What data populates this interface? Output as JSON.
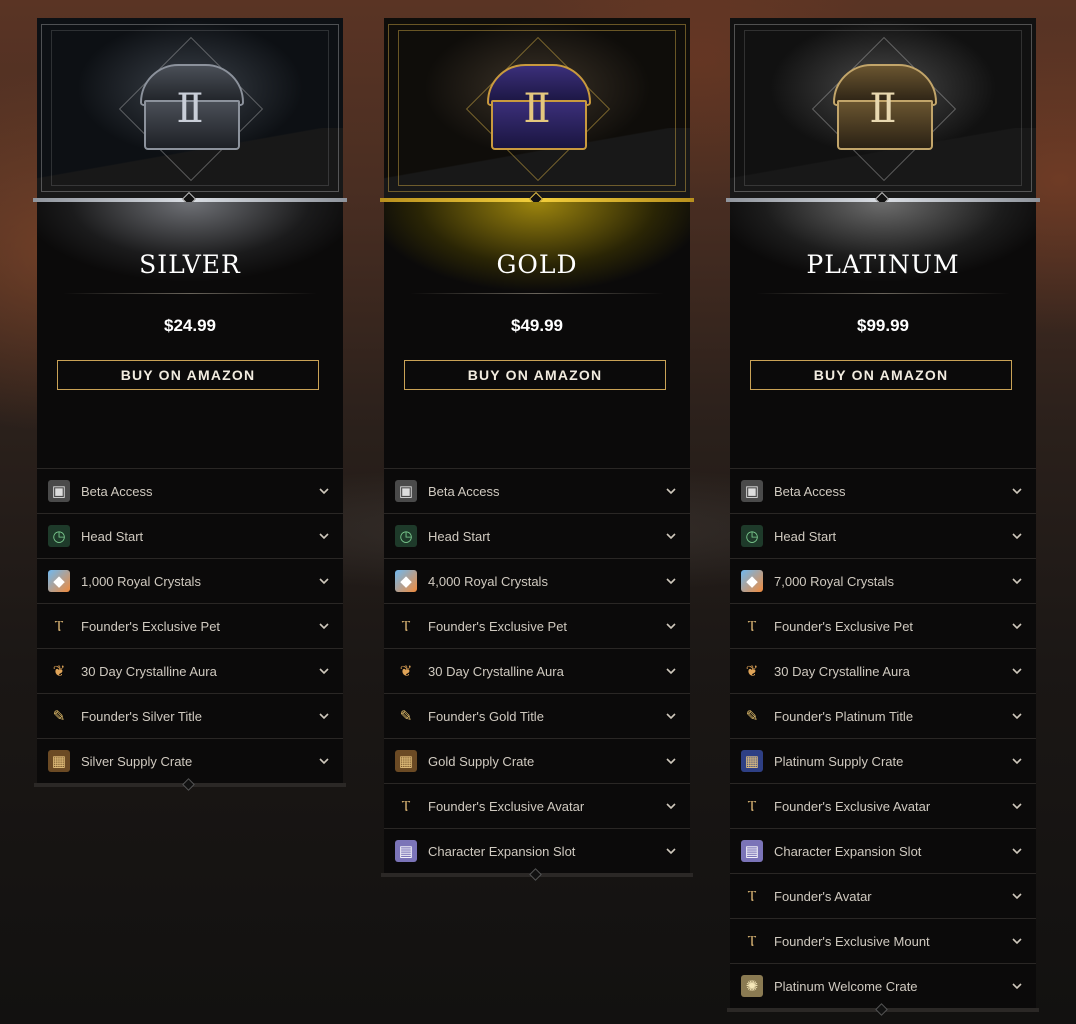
{
  "tiers": [
    {
      "key": "silver",
      "name": "SILVER",
      "price": "$24.99",
      "button": "BUY ON AMAZON",
      "items": [
        {
          "label": "Beta Access",
          "icon": "ticket-icon"
        },
        {
          "label": "Head Start",
          "icon": "clock-icon"
        },
        {
          "label": "1,000 Royal Crystals",
          "icon": "crystal-icon"
        },
        {
          "label": "Founder's Exclusive Pet",
          "icon": "pet-icon"
        },
        {
          "label": "30 Day Crystalline Aura",
          "icon": "aura-icon"
        },
        {
          "label": "Founder's Silver Title",
          "icon": "title-scroll-icon"
        },
        {
          "label": "Silver Supply Crate",
          "icon": "crate-icon"
        }
      ]
    },
    {
      "key": "gold",
      "name": "GOLD",
      "price": "$49.99",
      "button": "BUY ON AMAZON",
      "items": [
        {
          "label": "Beta Access",
          "icon": "ticket-icon"
        },
        {
          "label": "Head Start",
          "icon": "clock-icon"
        },
        {
          "label": "4,000 Royal Crystals",
          "icon": "crystal-icon"
        },
        {
          "label": "Founder's Exclusive Pet",
          "icon": "pet-icon"
        },
        {
          "label": "30 Day Crystalline Aura",
          "icon": "aura-icon"
        },
        {
          "label": "Founder's Gold Title",
          "icon": "title-scroll-icon"
        },
        {
          "label": "Gold Supply Crate",
          "icon": "crate-icon"
        },
        {
          "label": "Founder's Exclusive Avatar",
          "icon": "avatar-icon"
        },
        {
          "label": "Character Expansion Slot",
          "icon": "slot-ticket-icon"
        }
      ]
    },
    {
      "key": "platinum",
      "name": "PLATINUM",
      "price": "$99.99",
      "button": "BUY ON AMAZON",
      "items": [
        {
          "label": "Beta Access",
          "icon": "ticket-icon"
        },
        {
          "label": "Head Start",
          "icon": "clock-icon"
        },
        {
          "label": "7,000 Royal Crystals",
          "icon": "crystal-icon"
        },
        {
          "label": "Founder's Exclusive Pet",
          "icon": "pet-icon"
        },
        {
          "label": "30 Day Crystalline Aura",
          "icon": "aura-icon"
        },
        {
          "label": "Founder's Platinum Title",
          "icon": "title-scroll-icon"
        },
        {
          "label": "Platinum Supply Crate",
          "icon": "crate-blue-icon"
        },
        {
          "label": "Founder's Exclusive Avatar",
          "icon": "avatar-icon"
        },
        {
          "label": "Character Expansion Slot",
          "icon": "slot-ticket-icon"
        },
        {
          "label": "Founder's Avatar",
          "icon": "avatar-icon"
        },
        {
          "label": "Founder's Exclusive Mount",
          "icon": "mount-icon"
        },
        {
          "label": "Platinum Welcome Crate",
          "icon": "welcome-crate-icon"
        }
      ]
    }
  ],
  "colors": {
    "gold_accent": "#f3cf3c",
    "silver_accent": "#d9dde3",
    "button_border": "#c9a256"
  }
}
